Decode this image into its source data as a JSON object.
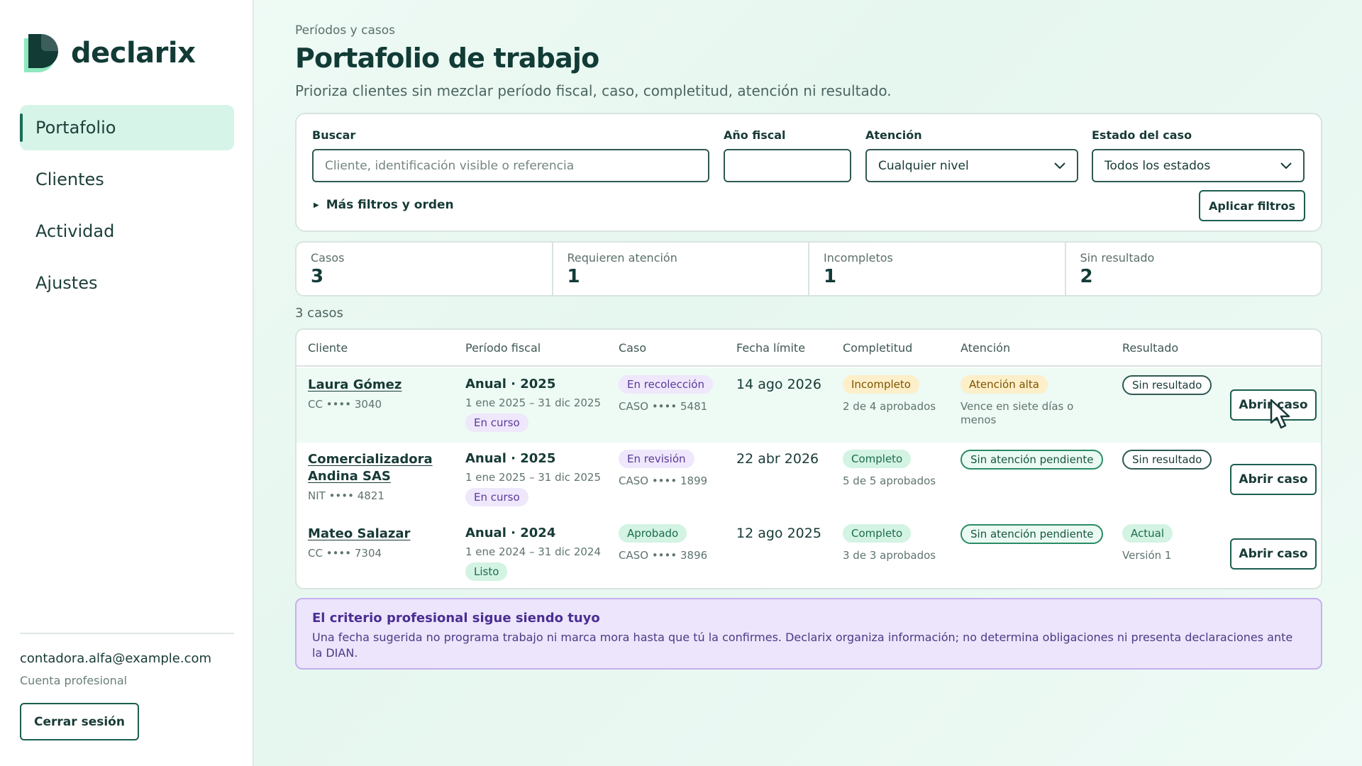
{
  "brand": {
    "name": "declarix"
  },
  "sidebar": {
    "items": [
      {
        "label": "Portafolio",
        "active": true
      },
      {
        "label": "Clientes"
      },
      {
        "label": "Actividad"
      },
      {
        "label": "Ajustes"
      }
    ],
    "user_email": "contadora.alfa@example.com",
    "user_role": "Cuenta profesional",
    "logout_label": "Cerrar sesión"
  },
  "header": {
    "breadcrumb": "Períodos y casos",
    "title": "Portafolio de trabajo",
    "subtitle": "Prioriza clientes sin mezclar período fiscal, caso, completitud, atención ni resultado."
  },
  "filters": {
    "search_label": "Buscar",
    "search_placeholder": "Cliente, identificación visible o referencia",
    "year_label": "Año fiscal",
    "year_value": "",
    "attention_label": "Atención",
    "attention_value": "Cualquier nivel",
    "status_label": "Estado del caso",
    "status_value": "Todos los estados",
    "more_label": "Más filtros y orden",
    "apply_label": "Aplicar filtros"
  },
  "stats": [
    {
      "label": "Casos",
      "value": "3"
    },
    {
      "label": "Requieren atención",
      "value": "1"
    },
    {
      "label": "Incompletos",
      "value": "1"
    },
    {
      "label": "Sin resultado",
      "value": "2"
    }
  ],
  "count_label": "3 casos",
  "table": {
    "headers": [
      "Cliente",
      "Período fiscal",
      "Caso",
      "Fecha límite",
      "Completitud",
      "Atención",
      "Resultado"
    ],
    "rows": [
      {
        "client": "Laura Gómez",
        "client_id": "CC •••• 3040",
        "period": "Anual · 2025",
        "period_range": "1 ene 2025 – 31 dic 2025",
        "period_status": "En curso",
        "case_status": "En recolección",
        "case_id": "CASO •••• 5481",
        "due": "14 ago 2026",
        "completeness": "Incompleto",
        "completeness_detail": "2 de 4 aprobados",
        "attention": "Atención alta",
        "attention_detail": "Vence en siete días o menos",
        "result": "Sin resultado",
        "result_detail": "",
        "action": "Abrir caso"
      },
      {
        "client": "Comercializadora Andina SAS",
        "client_id": "NIT •••• 4821",
        "period": "Anual · 2025",
        "period_range": "1 ene 2025 – 31 dic 2025",
        "period_status": "En curso",
        "case_status": "En revisión",
        "case_id": "CASO •••• 1899",
        "due": "22 abr 2026",
        "completeness": "Completo",
        "completeness_detail": "5 de 5 aprobados",
        "attention": "Sin atención pendiente",
        "attention_detail": "",
        "result": "Sin resultado",
        "result_detail": "",
        "action": "Abrir caso"
      },
      {
        "client": "Mateo Salazar",
        "client_id": "CC •••• 7304",
        "period": "Anual · 2024",
        "period_range": "1 ene 2024 – 31 dic 2024",
        "period_status": "Listo",
        "case_status": "Aprobado",
        "case_id": "CASO •••• 3896",
        "due": "12 ago 2025",
        "completeness": "Completo",
        "completeness_detail": "3 de 3 aprobados",
        "attention": "Sin atención pendiente",
        "attention_detail": "",
        "result": "Actual",
        "result_detail": "Versión 1",
        "action": "Abrir caso"
      }
    ]
  },
  "notice": {
    "title": "El criterio profesional sigue siendo tuyo",
    "text": "Una fecha sugerida no programa trabajo ni marca mora hasta que tú la confirmes. Declarix organiza información; no determina obligaciones ni presenta declaraciones ante la DIAN."
  },
  "colors": {
    "accent": "#1b5e4f",
    "nav_active_bg": "#d7f4e8",
    "notice_bg": "#ece5fb"
  }
}
